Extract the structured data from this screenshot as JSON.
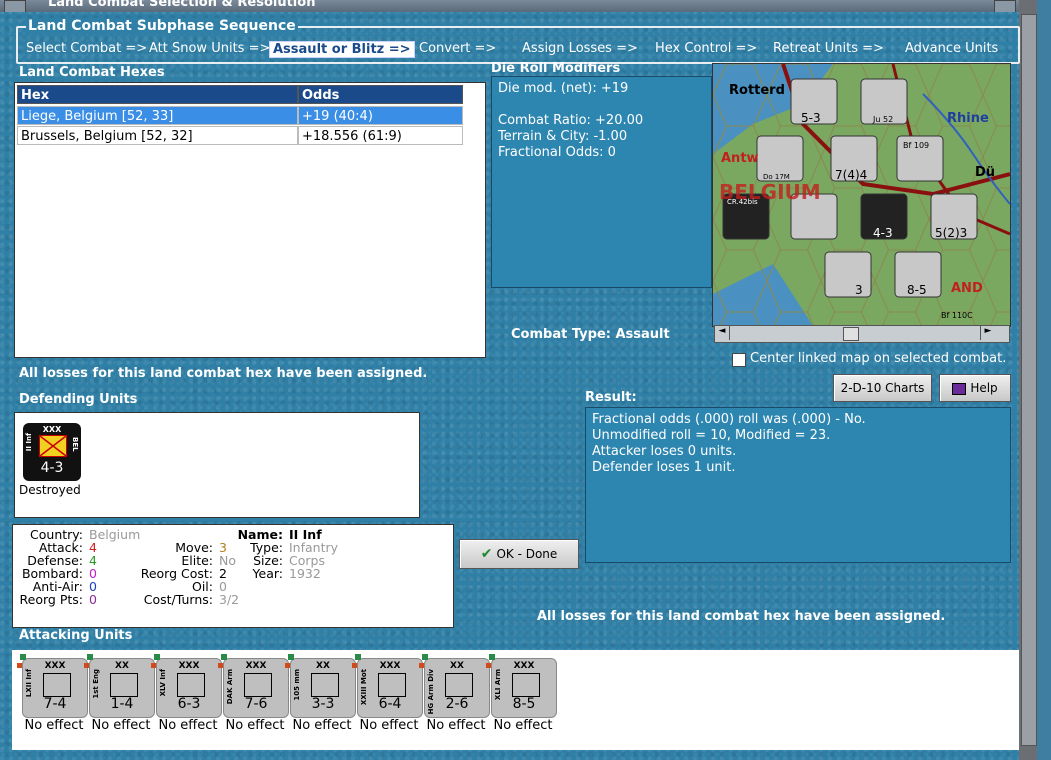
{
  "window": {
    "title": "Land Combat Selection & Resolution"
  },
  "sequence": {
    "legend": "Land Combat Subphase Sequence",
    "items": [
      "Select Combat =>",
      "Att Snow Units =>",
      "Assault or Blitz =>",
      "Convert =>",
      "Assign Losses =>",
      "Hex Control =>",
      "Retreat Units =>",
      "Advance Units"
    ],
    "active_index": 2
  },
  "hexes": {
    "label": "Land Combat Hexes",
    "columns": [
      "Hex",
      "Odds"
    ],
    "rows": [
      {
        "hex": "Liege, Belgium [52, 33]",
        "odds": "+19 (40:4)",
        "selected": true
      },
      {
        "hex": "Brussels, Belgium [52, 32]",
        "odds": "+18.556 (61:9)",
        "selected": false
      }
    ]
  },
  "modifiers": {
    "label": "Die Roll Modifiers",
    "net": "Die mod. (net): +19",
    "ratio": "Combat Ratio: +20.00",
    "terrain": "Terrain & City: -1.00",
    "fractional": "Fractional Odds: 0"
  },
  "combat_type": "Combat Type:  Assault",
  "center_linked": "Center linked map on selected combat.",
  "losses_msg": "All losses for this land combat hex have been assigned.",
  "buttons": {
    "charts": "2-D-10 Charts",
    "help": "Help",
    "ok": "OK - Done"
  },
  "defending": {
    "label": "Defending Units",
    "units": [
      {
        "name": "II Inf",
        "size": "XXX",
        "nation": "BEL",
        "str": "4-3",
        "effect": "Destroyed"
      }
    ]
  },
  "result": {
    "label": "Result:",
    "lines": [
      "Fractional odds (.000) roll was (.000)  - No.",
      "Unmodified roll = 10, Modified = 23.",
      "Attacker loses 0 units.",
      "Defender loses 1 unit."
    ]
  },
  "info": {
    "country_l": "Country:",
    "country": "Belgium",
    "attack_l": "Attack:",
    "attack": "4",
    "defense_l": "Defense:",
    "defense": "4",
    "bombard_l": "Bombard:",
    "bombard": "0",
    "aa_l": "Anti-Air:",
    "aa": "0",
    "reorg_l": "Reorg Pts:",
    "reorg": "0",
    "move_l": "Move:",
    "move": "3",
    "elite_l": "Elite:",
    "elite": "No",
    "reorgcost_l": "Reorg Cost:",
    "reorgcost": "2",
    "oil_l": "Oil:",
    "oil": "0",
    "cost_l": "Cost/Turns:",
    "cost": "3/2",
    "name_l": "Name:",
    "name": "II Inf",
    "type_l": "Type:",
    "type": "Infantry",
    "size_l": "Size:",
    "size": "Corps",
    "year_l": "Year:",
    "year": "1932"
  },
  "attacking": {
    "label": "Attacking Units",
    "units": [
      {
        "name": "LXII Inf",
        "size": "XXX",
        "str": "7-4",
        "effect": "No effect"
      },
      {
        "name": "1st Eng",
        "size": "XX",
        "str": "1-4",
        "effect": "No effect"
      },
      {
        "name": "XLV Inf",
        "size": "XXX",
        "str": "6-3",
        "effect": "No effect"
      },
      {
        "name": "DAK Arm",
        "size": "XXX",
        "str": "7-6",
        "effect": "No effect"
      },
      {
        "name": "105 mm",
        "size": "XX",
        "str": "3-3",
        "effect": "No effect"
      },
      {
        "name": "XXIII Mot",
        "size": "XXX",
        "str": "6-4",
        "effect": "No effect"
      },
      {
        "name": "HG Arm Div",
        "size": "XX",
        "str": "2-6",
        "effect": "No effect"
      },
      {
        "name": "XLI Arm",
        "size": "XXX",
        "str": "8-5",
        "effect": "No effect"
      }
    ]
  },
  "map": {
    "cities": [
      "Rotterd",
      "Antw",
      "BELGIUM",
      "Rhine",
      "Dü",
      "AND"
    ],
    "units": [
      {
        "str": "5-3"
      },
      {
        "str": "Ju 52"
      },
      {
        "str": "7(4)4"
      },
      {
        "str": "Do 17M"
      },
      {
        "str": "Bf 109"
      },
      {
        "str": "CR.42bis"
      },
      {
        "str": "4-3"
      },
      {
        "str": "5(2)3"
      },
      {
        "str": "3"
      },
      {
        "str": "8-5"
      },
      {
        "str": "Bf 110C"
      }
    ]
  },
  "colors": {
    "accent": "#1a4a8a",
    "panel": "#2d86b0",
    "sea": "#2f7fa6",
    "attack": "#d02020",
    "defense": "#2a9a2a",
    "bombard": "#c020c0"
  }
}
